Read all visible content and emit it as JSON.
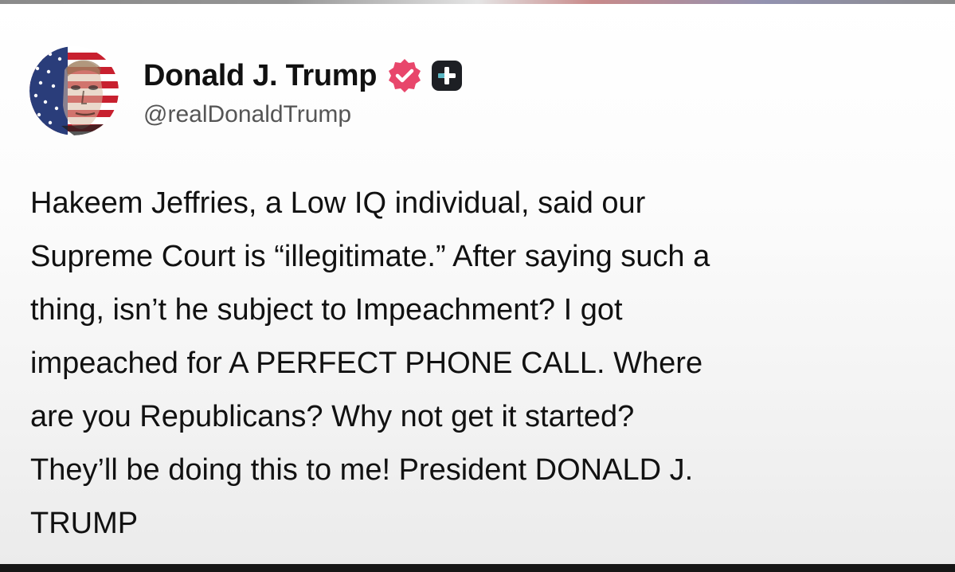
{
  "post": {
    "author": {
      "display_name": "Donald J. Trump",
      "handle": "@realDonaldTrump",
      "avatar_icon": "flag-portrait-avatar",
      "verified_icon": "verified-badge-icon",
      "plus_icon": "plus-badge-icon"
    },
    "body_lines": [
      "Hakeem Jeffries, a Low IQ individual, said our",
      "Supreme Court is “illegitimate.” After saying such a",
      "thing, isn’t he subject to Impeachment? I got",
      "impeached for A PERFECT PHONE CALL. Where",
      "are you Republicans? Why not get it started?",
      "They’ll be doing this to me! President DONALD J.",
      "TRUMP"
    ]
  },
  "colors": {
    "verified_badge": "#e8466b",
    "plus_badge": "#1d1f24",
    "plus_accent": "#5ab7c4",
    "text": "#111111",
    "handle_text": "#555555"
  }
}
